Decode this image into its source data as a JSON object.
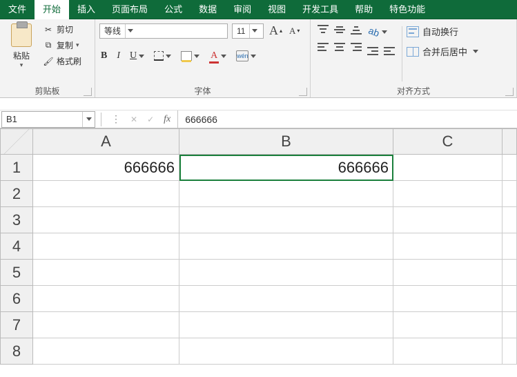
{
  "tabs": [
    "文件",
    "开始",
    "插入",
    "页面布局",
    "公式",
    "数据",
    "审阅",
    "视图",
    "开发工具",
    "帮助",
    "特色功能"
  ],
  "active_tab_index": 1,
  "clipboard": {
    "paste_label": "粘贴",
    "cut_label": "剪切",
    "copy_label": "复制",
    "format_painter_label": "格式刷",
    "group_label": "剪贴板"
  },
  "font": {
    "name": "等线",
    "size": "11",
    "bold": "B",
    "italic": "I",
    "underline": "U",
    "fontcolor_A": "A",
    "wen": "wén",
    "group_label": "字体"
  },
  "align": {
    "wrap_label": "自动换行",
    "merge_label": "合并后居中",
    "group_label": "对齐方式"
  },
  "fbar": {
    "namebox": "B1",
    "cancel": "✕",
    "accept": "✓",
    "fx": "fx",
    "value": "666666"
  },
  "grid": {
    "cols": [
      "A",
      "B",
      "C",
      ""
    ],
    "rows": [
      "1",
      "2",
      "3",
      "4",
      "5",
      "6",
      "7",
      "8"
    ],
    "cells": {
      "A1": "666666",
      "B1": "666666"
    },
    "selected": "B1"
  }
}
